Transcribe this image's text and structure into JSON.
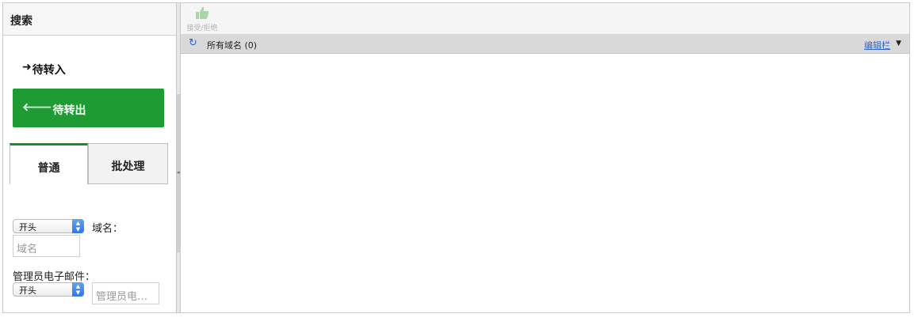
{
  "left": {
    "title": "搜索",
    "nav": {
      "in_label": "待转入",
      "in_icon": "arrow-right-icon",
      "out_label": "待转出",
      "out_icon": "arrow-left-icon"
    },
    "tabs": [
      {
        "label": "普通",
        "active": true
      },
      {
        "label": "批处理",
        "active": false
      }
    ],
    "filters": {
      "domain": {
        "match_value": "开头",
        "label": "域名：",
        "placeholder": "域名"
      },
      "admin_email": {
        "label": "管理员电子邮件：",
        "match_value": "开头",
        "placeholder": "管理员电…"
      }
    }
  },
  "right": {
    "toolbar": {
      "accept_reject_label": "接受/拒绝",
      "accept_reject_icon": "thumbs-up-icon"
    },
    "list": {
      "title": "所有域名 (0)",
      "refresh_icon": "refresh-icon",
      "edit_columns_label": "编辑栏",
      "caret_icon": "caret-down-icon"
    }
  },
  "colors": {
    "accent_green": "#1e9b32",
    "link_blue": "#2f66c8"
  }
}
